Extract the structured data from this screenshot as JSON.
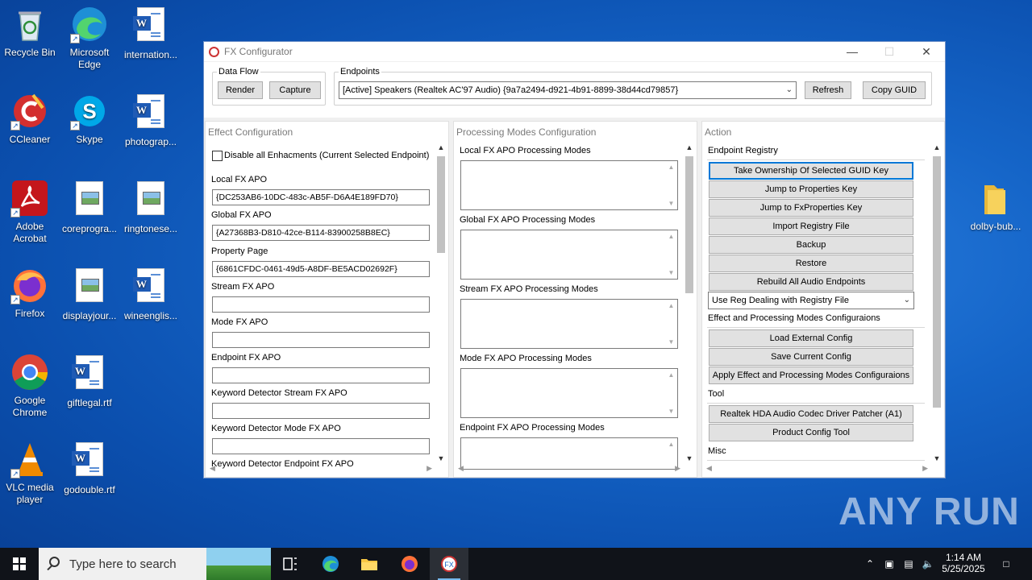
{
  "desktop": {
    "icons": [
      {
        "label": "Recycle Bin"
      },
      {
        "label": "Microsoft Edge"
      },
      {
        "label": "internation..."
      },
      {
        "label": "CCleaner"
      },
      {
        "label": "Skype"
      },
      {
        "label": "photograp..."
      },
      {
        "label": "Adobe Acrobat"
      },
      {
        "label": "coreprogra..."
      },
      {
        "label": "ringtonese..."
      },
      {
        "label": "Firefox"
      },
      {
        "label": "displayjour..."
      },
      {
        "label": "wineenglis..."
      },
      {
        "label": "Google Chrome"
      },
      {
        "label": "giftlegal.rtf"
      },
      {
        "label": "VLC media player"
      },
      {
        "label": "godouble.rtf"
      },
      {
        "label": "dolby-bub..."
      }
    ],
    "watermark": "ANY RUN"
  },
  "window": {
    "title": "FX Configurator",
    "controls": {
      "minimize": "—",
      "maximize": "☐",
      "close": "✕"
    }
  },
  "data_flow": {
    "legend": "Data Flow",
    "render_label": "Render",
    "capture_label": "Capture"
  },
  "endpoints": {
    "legend": "Endpoints",
    "selected": "[Active] Speakers (Realtek AC'97 Audio) {9a7a2494-d921-4b91-8899-38d44cd79857}",
    "refresh_label": "Refresh",
    "copy_guid_label": "Copy GUID"
  },
  "effect_config": {
    "title": "Effect Configuration",
    "disable_all_label": "Disable all Enhacments (Current Selected Endpoint)",
    "disable_all_checked": false,
    "fields": [
      {
        "label": "Local FX APO",
        "value": "{DC253AB6-10DC-483c-AB5F-D6A4E189FD70}"
      },
      {
        "label": "Global FX APO",
        "value": "{A27368B3-D810-42ce-B114-83900258B8EC}"
      },
      {
        "label": "Property Page",
        "value": "{6861CFDC-0461-49d5-A8DF-BE5ACD02692F}"
      },
      {
        "label": "Stream FX APO",
        "value": ""
      },
      {
        "label": "Mode FX APO",
        "value": ""
      },
      {
        "label": "Endpoint FX APO",
        "value": ""
      },
      {
        "label": "Keyword Detector Stream FX APO",
        "value": ""
      },
      {
        "label": "Keyword Detector Mode FX APO",
        "value": ""
      },
      {
        "label": "Keyword Detector Endpoint FX APO",
        "value": ""
      }
    ]
  },
  "processing_modes": {
    "title": "Processing Modes Configuration",
    "lists": [
      {
        "label": "Local FX APO Processing Modes"
      },
      {
        "label": "Global FX APO Processing Modes"
      },
      {
        "label": "Stream FX APO Processing Modes"
      },
      {
        "label": "Mode FX APO Processing Modes"
      },
      {
        "label": "Endpoint FX APO Processing Modes"
      }
    ]
  },
  "action": {
    "title": "Action",
    "endpoint_registry": {
      "heading": "Endpoint Registry",
      "buttons": [
        "Take Ownership Of Selected GUID Key",
        "Jump to Properties Key",
        "Jump to FxProperties Key",
        "Import Registry File",
        "Backup",
        "Restore",
        "Rebuild All Audio Endpoints"
      ],
      "reg_mode_selected": "Use Reg Dealing with Registry File"
    },
    "effect_modes": {
      "heading": "Effect and Processing Modes Configuraions",
      "buttons": [
        "Load External Config",
        "Save Current Config",
        "Apply Effect and Processing Modes Configuraions"
      ]
    },
    "tool": {
      "heading": "Tool",
      "buttons": [
        "Realtek HDA Audio Codec Driver Patcher (A1)",
        "Product Config Tool"
      ]
    },
    "misc": {
      "heading": "Misc"
    }
  },
  "taskbar": {
    "search_placeholder": "Type here to search",
    "time": "1:14 AM",
    "date": "5/25/2025"
  },
  "colors": {
    "accent": "#0078d7",
    "desktop": "#1565c8",
    "taskbar": "#101319"
  }
}
